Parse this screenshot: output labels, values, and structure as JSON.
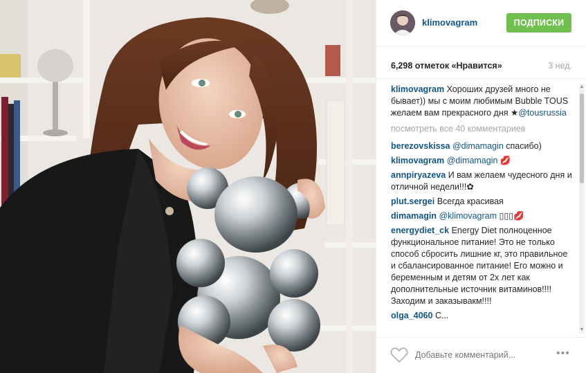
{
  "post": {
    "username": "klimovagram",
    "follow_label": "ПОДПИСКИ",
    "likes": "6,298 отметок «Нравится»",
    "time": "3 нед."
  },
  "caption": {
    "author": "klimovagram",
    "text": "Хороших друзей много не бывает)) мы с моим любимым Bubble TOUS желаем вам прекрасного дня",
    "star": "★",
    "mention": "@tousrussia"
  },
  "view_all": "посмотреть все 40 комментариев",
  "comments": [
    {
      "author": "berezovskissa",
      "mention": "@dimamagin",
      "text": " спасибо)"
    },
    {
      "author": "klimovagram",
      "mention": "@dimamagin",
      "text": " 💋"
    },
    {
      "author": "annpiryazeva",
      "mention": "",
      "text": "И вам желаем чудесного дня и отличной недели!!!✿"
    },
    {
      "author": "plut.sergei",
      "mention": "",
      "text": "Всегда красивая"
    },
    {
      "author": "dimamagin",
      "mention": "@klimovagram",
      "text": " ▯▯▯💋"
    },
    {
      "author": "energydiet_ck",
      "mention": "",
      "text": "Energy Diet полноценное функциональное питание! Это не только способ сбросить лишние кг, это правильное и сбалансированное питание! Его можно и беременным и детям от 2х лет как дополнительные источник витаминов!!!! Заходим и заказывакм!!!!"
    },
    {
      "author": "olga_4060",
      "mention": "",
      "text": "С..."
    }
  ],
  "footer": {
    "add_comment_placeholder": "Добавьте комментарий...",
    "more": "•••"
  },
  "icons": {
    "heart": "heart-icon",
    "more": "more-options-icon"
  },
  "colors": {
    "link": "#125688",
    "follow": "#70c050",
    "muted": "#a5a7aa"
  }
}
